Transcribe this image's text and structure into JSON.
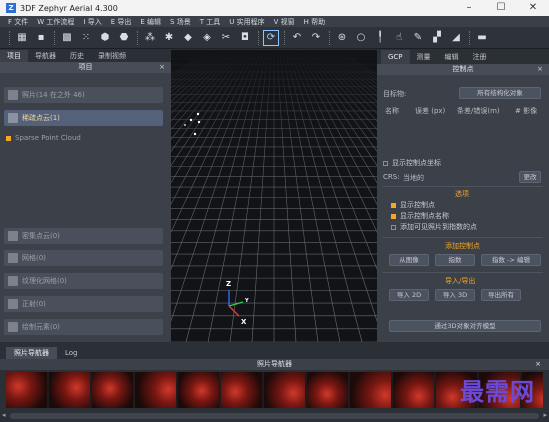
{
  "window": {
    "title": "3DF Zephyr Aerial 4.300",
    "app_icon": "Z",
    "minimize": "–",
    "maximize": "☐",
    "close": "✕"
  },
  "menu": [
    "F 文件",
    "W 工作流程",
    "I 导入",
    "E 导出",
    "E 编辑",
    "S 场景",
    "T 工具",
    "U 实用程序",
    "V 视窗",
    "H 帮助"
  ],
  "toolbar_icons": [
    "palette-icon",
    "save-icon",
    "grid-icon",
    "points-icon",
    "mesh-icon",
    "solid-mesh-icon",
    "gear-icon",
    "mesh-wire-icon",
    "mesh-cube-icon",
    "lasso-icon",
    "cube-icon",
    "camera-icon",
    "sync-icon",
    "undo-icon",
    "redo-icon",
    "point-select-icon",
    "circle-icon",
    "pin-icon",
    "hand-icon",
    "paint-icon",
    "ruler-icon",
    "more-icon"
  ],
  "left_panel": {
    "tabs": [
      "项目",
      "导航器",
      "历史",
      "录制视频"
    ],
    "header": "项目",
    "close": "×",
    "photos": "照片(14 在之外 46)",
    "sparse": "稀疏点云(1)",
    "sparse_item": "Sparse Point Cloud",
    "dense": "密集点云(0)",
    "mesh": "网格(0)",
    "textured": "纹理化网格(0)",
    "ortho": "正射(0)",
    "drawing": "绘制元素(0)"
  },
  "viewport": {
    "axis_z": "Z",
    "axis_y": "Y",
    "axis_x": "X"
  },
  "right_panel": {
    "tabs": [
      "GCP",
      "测量",
      "编辑",
      "注册"
    ],
    "header": "控制点",
    "close": "×",
    "target_label": "目标物:",
    "target_value": "所有结构化对象",
    "col_name": "名称",
    "col_error": "误差 (px)",
    "col_bundle": "条差/错误(m)",
    "col_images": "# 影像",
    "show_coords": "显示控制点坐标",
    "crs_label": "CRS:",
    "crs_value": "当地的",
    "crs_change": "更改",
    "options_title": "选项",
    "opt_show_points": "显示控制点",
    "opt_show_names": "显示控制点名称",
    "opt_add_visible": "添加可见照片到指数的点",
    "add_title": "添加控制点",
    "btn_from_image": "从图像",
    "btn_pick": "指数",
    "btn_pick_edit": "指数 -> 编辑",
    "io_title": "导入/导出",
    "btn_import_2d": "导入 2D",
    "btn_import_3d": "导入 3D",
    "btn_export_all": "导出所有",
    "btn_register": "通过3D对象对齐模型"
  },
  "bottom": {
    "tabs": [
      "照片导航器",
      "Log"
    ],
    "nav_title": "照片导航器",
    "close": "×",
    "thumb_count": 13
  },
  "watermark": "最需网",
  "colors": {
    "accent": "#f5a623",
    "panel": "#3b4049",
    "viewport": "#111316",
    "watermark": "#6a4bd8"
  }
}
